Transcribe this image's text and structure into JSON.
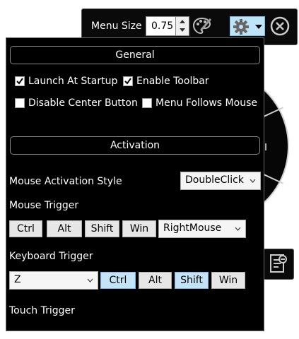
{
  "toolbar": {
    "menu_size_label": "Menu Size",
    "menu_size_value": "0.75",
    "icons": [
      "palette-icon",
      "gear-icon",
      "caret-down-icon",
      "close-circle-icon"
    ]
  },
  "panel": {
    "general": {
      "header": "General",
      "launch_at_startup": {
        "label": "Launch At Startup",
        "checked": true
      },
      "enable_toolbar": {
        "label": "Enable Toolbar",
        "checked": true
      },
      "disable_center_button": {
        "label": "Disable Center Button",
        "checked": false
      },
      "menu_follows_mouse": {
        "label": "Menu Follows Mouse",
        "checked": false
      }
    },
    "activation": {
      "header": "Activation",
      "mouse_activation_style": {
        "label": "Mouse Activation Style",
        "value": "DoubleClick"
      },
      "mouse_trigger": {
        "label": "Mouse Trigger",
        "modifiers": [
          {
            "label": "Ctrl",
            "active": false
          },
          {
            "label": "Alt",
            "active": false
          },
          {
            "label": "Shift",
            "active": false
          },
          {
            "label": "Win",
            "active": false
          }
        ],
        "button": "RightMouse"
      },
      "keyboard_trigger": {
        "label": "Keyboard Trigger",
        "key": "Z",
        "modifiers": [
          {
            "label": "Ctrl",
            "active": true
          },
          {
            "label": "Alt",
            "active": false
          },
          {
            "label": "Shift",
            "active": true
          },
          {
            "label": "Win",
            "active": false
          }
        ]
      },
      "touch_trigger": {
        "label": "Touch Trigger"
      }
    }
  },
  "colors": {
    "panel_bg": "#000000",
    "active_toggle": "#c4e3f7",
    "gear_button_bg": "#bfe3f8"
  }
}
